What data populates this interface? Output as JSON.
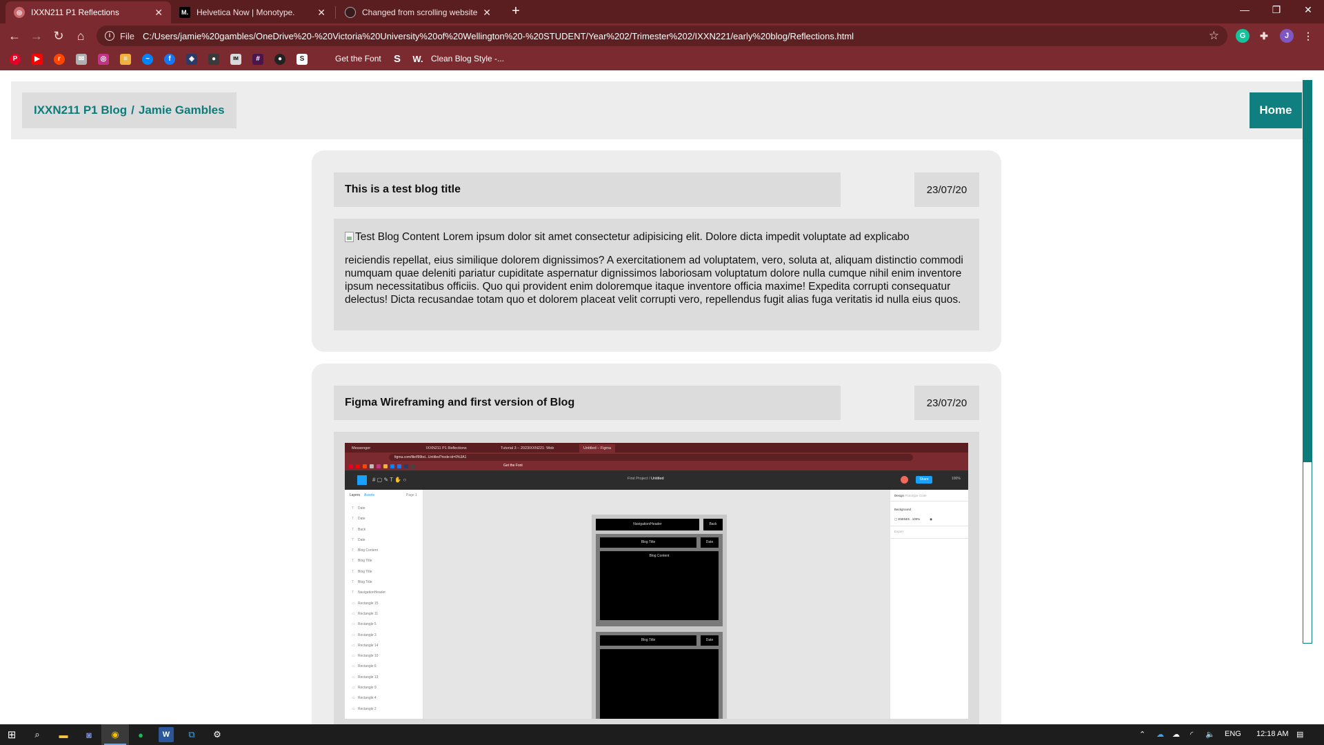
{
  "browser": {
    "tabs": [
      {
        "title": "IXXN211 P1 Reflections",
        "favicon": "chrome-page-icon",
        "active": true
      },
      {
        "title": "Helvetica Now | Monotype.",
        "favicon": "monotype-icon",
        "active": false
      },
      {
        "title": "Changed from scrolling website",
        "favicon": "github-icon",
        "active": false
      }
    ],
    "address": {
      "scheme": "File",
      "url": "C:/Users/jamie%20gambles/OneDrive%20-%20Victoria%20University%20of%20Wellington%20-%20STUDENT/Year%202/Trimester%202/IXXN221/early%20blog/Reflections.html"
    },
    "profile_initial": "J",
    "bookmarks": [
      {
        "label": "Get the Font",
        "icon": "get-the-font-icon"
      },
      {
        "label": "Clean Blog Style -...",
        "icon": "w-icon"
      }
    ],
    "bookmark_icons": [
      "pinterest-icon",
      "youtube-icon",
      "reddit-icon",
      "mail-icon",
      "instagram-icon",
      "feed-icon",
      "messenger-icon",
      "facebook-icon",
      "app-icon",
      "flickr-icon",
      "imdb-icon",
      "slack-icon",
      "github-icon",
      "s-icon"
    ]
  },
  "site": {
    "brand_course": "IXXN211 P1 Blog",
    "brand_separator": "/",
    "brand_author": "Jamie Gambles",
    "home_label": "Home",
    "accent_color": "#0e7b7b"
  },
  "posts": [
    {
      "title": "This is a test blog title",
      "date": "23/07/20",
      "image_alt": "Test Blog Content",
      "content_first_line": "Lorem ipsum dolor sit amet consectetur adipisicing elit. Dolore dicta impedit voluptate ad explicabo",
      "content_rest": "reiciendis repellat, eius similique dolorem dignissimos? A exercitationem ad voluptatem, vero, soluta at, aliquam distinctio commodi numquam quae deleniti pariatur cupiditate aspernatur dignissimos laboriosam voluptatum dolore nulla cumque nihil enim inventore ipsum necessitatibus officiis. Quo qui provident enim doloremque itaque inventore officia maxime! Expedita corrupti consequatur delectus! Dicta recusandae totam quo et dolorem placeat velit corrupti vero, repellendus fugit alias fuga veritatis id nulla eius quos."
    },
    {
      "title": "Figma Wireframing and first version of Blog",
      "date": "23/07/20"
    }
  ],
  "figma_screenshot": {
    "tabs": [
      "Messenger",
      "IXXN211 P1 Reflections",
      "Tutorial 3 – 2023IXXN221: Web",
      "Untitled – Figma"
    ],
    "url": "figma.com/file/f99bd...Untitled?node-id=0%3A1",
    "bookmark_text": "Get the Font",
    "project": "First Project",
    "file_name": "Untitled",
    "share_label": "Share",
    "zoom": "100%",
    "panel_tabs": [
      "Layers",
      "Assets"
    ],
    "page_label": "Page 1",
    "layers": [
      "Date",
      "Date",
      "Back",
      "Date",
      "Blog Content",
      "Blog Title",
      "Blog Title",
      "Blog Title",
      "NavigationHeader",
      "Rectangle 15",
      "Rectangle 11",
      "Rectangle 5",
      "Rectangle 3",
      "Rectangle 14",
      "Rectangle 10",
      "Rectangle 6",
      "Rectangle 13",
      "Rectangle 9",
      "Rectangle 4",
      "Rectangle 2"
    ],
    "right_tabs": [
      "Design",
      "Prototype",
      "Code"
    ],
    "background_label": "Background",
    "background_value": "E5E5E5",
    "background_opacity": "100%",
    "export_label": "Export",
    "wire": {
      "nav": "Navigation/Header",
      "back": "Back",
      "blog_title": "Blog Title",
      "date": "Date",
      "blog_content": "Blog Content"
    }
  },
  "taskbar": {
    "language": "ENG",
    "time": "12:18 AM"
  }
}
